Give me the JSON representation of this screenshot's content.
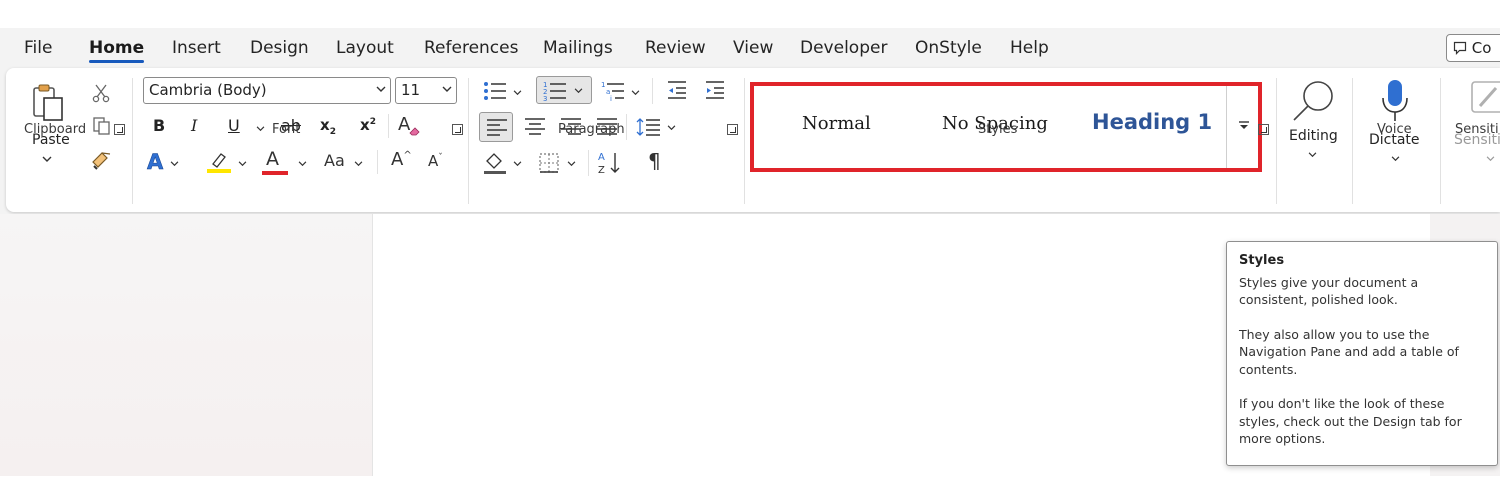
{
  "tabs": [
    "File",
    "Home",
    "Insert",
    "Design",
    "Layout",
    "References",
    "Mailings",
    "Review",
    "View",
    "Developer",
    "OnStyle",
    "Help"
  ],
  "active_tab": "Home",
  "comments_label": "Co",
  "clipboard": {
    "paste_label": "Paste",
    "group_label": "Clipboard"
  },
  "font": {
    "font_name": "Cambria (Body)",
    "font_size": "11",
    "bold": "B",
    "italic": "I",
    "underline": "U",
    "strike": "ab",
    "subscript": "x",
    "subscript_mark": "2",
    "superscript": "x",
    "superscript_mark": "2",
    "font_color_letter": "A",
    "change_case": "Aa",
    "grow": "A",
    "shrink": "A",
    "text_effects": "A",
    "clear_format": "A",
    "group_label": "Font",
    "underline_color": "#e0242a",
    "highlight_color": "#ffe600"
  },
  "paragraph": {
    "group_label": "Paragraph",
    "pilcrow": "¶"
  },
  "styles": {
    "items": [
      "Normal",
      "No Spacing",
      "Heading 1"
    ],
    "group_label": "Styles",
    "heading_color": "#2e5597"
  },
  "editing": {
    "label": "Editing"
  },
  "voice": {
    "dictate_label": "Dictate",
    "group_label": "Voice"
  },
  "sensitivity": {
    "label": "Sensiti",
    "group_label": "Sensiti"
  },
  "tooltip": {
    "title": "Styles",
    "p1": "Styles give your document a consistent, polished look.",
    "p2": "They also allow you to use the Navigation Pane and add a table of contents.",
    "p3": "If you don't like the look of these styles, check out the Design tab for more options."
  },
  "colors": {
    "accent": "#185abd",
    "highlight_box": "#e0242a",
    "dictate_blue": "#2f6fd1"
  }
}
